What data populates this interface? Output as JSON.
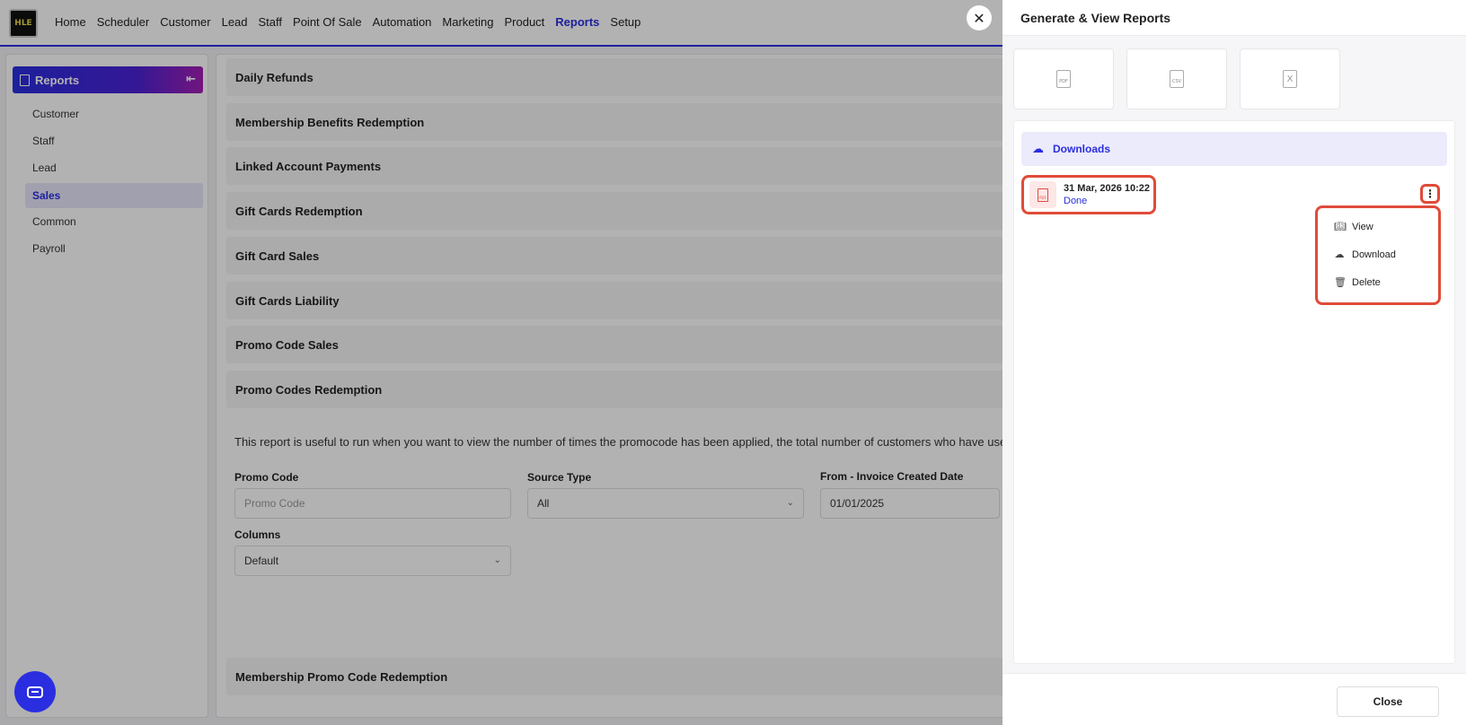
{
  "nav": {
    "logo_text": "HLE",
    "items": [
      "Home",
      "Scheduler",
      "Customer",
      "Lead",
      "Staff",
      "Point Of Sale",
      "Automation",
      "Marketing",
      "Product",
      "Reports",
      "Setup"
    ],
    "active": "Reports"
  },
  "sidebar": {
    "title": "Reports",
    "items": [
      "Customer",
      "Staff",
      "Lead",
      "Sales",
      "Common",
      "Payroll"
    ],
    "active": "Sales"
  },
  "main": {
    "sections": [
      "Daily Refunds",
      "Membership Benefits Redemption",
      "Linked Account Payments",
      "Gift Cards Redemption",
      "Gift Card Sales",
      "Gift Cards Liability",
      "Promo Code Sales",
      "Promo Codes Redemption"
    ],
    "description": "This report is useful to run when you want to view the number of times the promocode has been applied, the total number of customers who have used the pro",
    "fields": {
      "promo_code_label": "Promo Code",
      "promo_code_placeholder": "Promo Code",
      "source_type_label": "Source Type",
      "source_type_value": "All",
      "from_date_label": "From - Invoice Created Date",
      "from_date_value": "01/01/2025",
      "columns_label": "Columns",
      "columns_value": "Default"
    },
    "last_section": "Membership Promo Code Redemption"
  },
  "drawer": {
    "title": "Generate & View Reports",
    "format_tiles": [
      "PDF",
      "CSV",
      "X"
    ],
    "downloads_label": "Downloads",
    "file": {
      "date": "31 Mar, 2026 10:22",
      "status": "Done",
      "type": "PDF"
    },
    "menu": [
      "View",
      "Download",
      "Delete"
    ],
    "close_label": "Close"
  },
  "colors": {
    "accent": "#2a2ee0",
    "highlight": "#e04b3a"
  }
}
